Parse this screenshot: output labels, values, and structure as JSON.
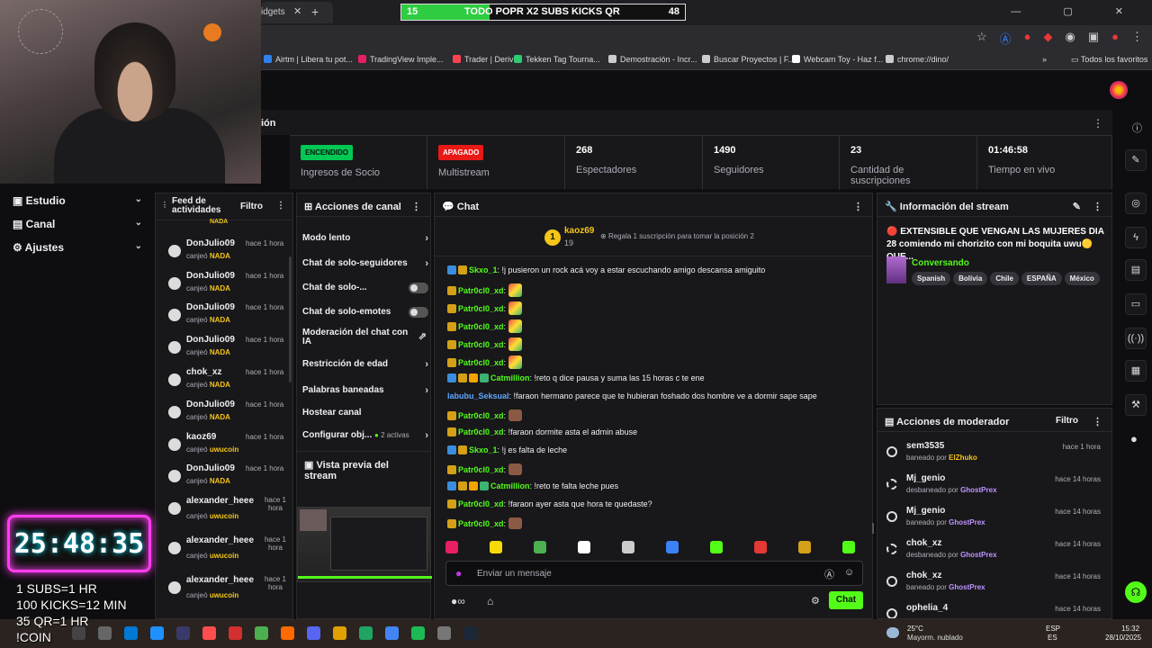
{
  "browser": {
    "tab_title": "idgets",
    "tab_close": "✕",
    "new_tab": "+",
    "window_controls": "— ▢ ✕"
  },
  "goal_bar": {
    "start": "15",
    "text": "TODO POPR X2 SUBS KICKS QR",
    "end": "48",
    "progress": 0.31,
    "color": "#2ecc40"
  },
  "bookmarks": [
    {
      "label": "Airtm | Libera tu pot...",
      "color": "#2f80ed"
    },
    {
      "label": "TradingView Imple...",
      "color": "#e91e63"
    },
    {
      "label": "Trader | Deriv",
      "color": "#ff444f"
    },
    {
      "label": "Tekken Tag Tourna...",
      "color": "#2ecc71"
    },
    {
      "label": "Demostración - Incr...",
      "color": "#cccccc"
    },
    {
      "label": "Buscar Proyectos | F...",
      "color": "#cccccc"
    },
    {
      "label": "Webcam Toy - Haz f...",
      "color": "#ffffff"
    },
    {
      "label": "chrome://dino/",
      "color": "#cccccc"
    }
  ],
  "bookmarks_more": "»",
  "bookmarks_all": "Todos los favoritos",
  "section_title": "ión",
  "stats": [
    {
      "badge": "ENCENDIDO",
      "badge_color": "#00c853",
      "label": "Ingresos de Socio"
    },
    {
      "badge": "APAGADO",
      "badge_color": "#e91916",
      "label": "Multistream"
    },
    {
      "value": "268",
      "label": "Espectadores"
    },
    {
      "value": "1490",
      "label": "Seguidores"
    },
    {
      "value": "23",
      "label": "Cantidad de suscripciones"
    },
    {
      "value": "01:46:58",
      "label": "Tiempo en vivo"
    }
  ],
  "sidebar": {
    "items": [
      {
        "label": "Estudio"
      },
      {
        "label": "Canal"
      },
      {
        "label": "Ajustes"
      }
    ]
  },
  "feed": {
    "title": "Feed de actividades",
    "filter": "Filtro",
    "cut_top": "NADA",
    "items": [
      {
        "name": "DonJulio09",
        "time": "hace 1 hora",
        "action": "canjeó",
        "reward": "NADA"
      },
      {
        "name": "DonJulio09",
        "time": "hace 1 hora",
        "action": "canjeó",
        "reward": "NADA"
      },
      {
        "name": "DonJulio09",
        "time": "hace 1 hora",
        "action": "canjeó",
        "reward": "NADA"
      },
      {
        "name": "DonJulio09",
        "time": "hace 1 hora",
        "action": "canjeó",
        "reward": "NADA"
      },
      {
        "name": "chok_xz",
        "time": "hace 1 hora",
        "action": "canjeó",
        "reward": "NADA"
      },
      {
        "name": "DonJulio09",
        "time": "hace 1 hora",
        "action": "canjeó",
        "reward": "NADA"
      },
      {
        "name": "kaoz69",
        "time": "hace 1 hora",
        "action": "canjeó",
        "reward": "uwucoin"
      },
      {
        "name": "DonJulio09",
        "time": "hace 1 hora",
        "action": "canjeó",
        "reward": "NADA"
      },
      {
        "name": "alexander_heee",
        "time": "hace 1 hora",
        "action": "canjeó",
        "reward": "uwucoin"
      },
      {
        "name": "alexander_heee",
        "time": "hace 1 hora",
        "action": "canjeó",
        "reward": "uwucoin"
      },
      {
        "name": "alexander_heee",
        "time": "hace 1 hora",
        "action": "canjeó",
        "reward": "uwucoin"
      }
    ]
  },
  "actions": {
    "title": "Acciones de canal",
    "items": [
      {
        "label": "Modo lento",
        "type": "arrow"
      },
      {
        "label": "Chat de solo-seguidores",
        "type": "arrow"
      },
      {
        "label": "Chat de solo-...",
        "type": "toggle"
      },
      {
        "label": "Chat de solo-emotes",
        "type": "toggle"
      },
      {
        "label": "Moderación del chat con IA",
        "type": "link"
      },
      {
        "label": "Restricción de edad",
        "type": "arrow"
      },
      {
        "label": "Palabras baneadas",
        "type": "arrow"
      },
      {
        "label": "Hostear canal",
        "type": "none"
      },
      {
        "label": "Configurar obj...",
        "type": "arrow",
        "extra": "2 activas"
      }
    ],
    "preview_title": "Vista previa del stream"
  },
  "chat": {
    "title": "Chat",
    "top_gifter": {
      "name": "kaoz69",
      "count": "19",
      "rank": "1",
      "hint": "Regala 1 suscripción para tomar la posición 2"
    },
    "lines": [
      {
        "user": "Skxo_1",
        "color": "#53fc18",
        "text": "!j pusieron un rock acá voy a estar escuchando amigo descansa amiguito",
        "badges": [
          "#3a8dde",
          "#d4a017"
        ]
      },
      {
        "user": "Patr0cl0_xd",
        "color": "#53fc18",
        "text": "",
        "emote": "rainbow",
        "badges": [
          "#d4a017"
        ]
      },
      {
        "user": "Patr0cl0_xd",
        "color": "#53fc18",
        "text": "",
        "emote": "rainbow",
        "badges": [
          "#d4a017"
        ]
      },
      {
        "user": "Patr0cl0_xd",
        "color": "#53fc18",
        "text": "",
        "emote": "rainbow",
        "badges": [
          "#d4a017"
        ]
      },
      {
        "user": "Patr0cl0_xd",
        "color": "#53fc18",
        "text": "",
        "emote": "rainbow",
        "badges": [
          "#d4a017"
        ]
      },
      {
        "user": "Patr0cl0_xd",
        "color": "#53fc18",
        "text": "",
        "emote": "rainbow",
        "badges": [
          "#d4a017"
        ]
      },
      {
        "user": "Catmillion",
        "color": "#53fc18",
        "text": "!reto q dice pausa y suma las 15 horas c te ene",
        "badges": [
          "#3a8dde",
          "#d4a017",
          "#f5a300",
          "#3cb371"
        ]
      },
      {
        "user": "labubu_Seksual",
        "color": "#5fa8ff",
        "text": "!faraon hermano parece que te hubieran foshado dos hombre ve a dormir sape sape",
        "badges": []
      },
      {
        "user": "Patr0cl0_xd",
        "color": "#53fc18",
        "text": "",
        "emote": "brown",
        "badges": [
          "#d4a017"
        ]
      },
      {
        "user": "Patr0cl0_xd",
        "color": "#53fc18",
        "text": "!faraon dormite asta el admin abuse",
        "badges": [
          "#d4a017"
        ]
      },
      {
        "user": "Skxo_1",
        "color": "#53fc18",
        "text": "!j es falta de leche",
        "badges": [
          "#3a8dde",
          "#d4a017"
        ]
      },
      {
        "user": "Patr0cl0_xd",
        "color": "#53fc18",
        "text": "",
        "emote": "brown",
        "badges": [
          "#d4a017"
        ]
      },
      {
        "user": "Catmillion",
        "color": "#53fc18",
        "text": "!reto te falta leche pues",
        "badges": [
          "#3a8dde",
          "#d4a017",
          "#f5a300",
          "#3cb371"
        ]
      },
      {
        "user": "Patr0cl0_xd",
        "color": "#53fc18",
        "text": "!faraon ayer asta que hora te quedaste?",
        "badges": [
          "#d4a017"
        ]
      },
      {
        "user": "Patr0cl0_xd",
        "color": "#53fc18",
        "text": "",
        "emote": "brown",
        "badges": [
          "#d4a017"
        ]
      }
    ],
    "emote_bar": [
      "#e91e63",
      "#f5d90a",
      "#4caf50",
      "#ffffff",
      "#cccccc",
      "#3b82f6",
      "#53fc18",
      "#e53935",
      "#d4a017",
      "#53fc18"
    ],
    "input_placeholder": "Enviar un mensaje",
    "send_label": "Chat"
  },
  "stream_info": {
    "title": "Información del stream",
    "stream_title": "🔴 EXTENSIBLE QUE VENGAN LAS MUJERES DIA 28 comiendo mi chorizito con mi boquita uwu🟡 QUE...",
    "category": "Conversando",
    "tags": [
      "Spanish",
      "Bolivia",
      "Chile",
      "ESPAÑA",
      "México"
    ]
  },
  "mod_actions": {
    "title": "Acciones de moderador",
    "filter": "Filtro",
    "items": [
      {
        "name": "sem3535",
        "action": "baneado por",
        "by": "ElZhuko",
        "time": "hace 1 hora",
        "icon": "ban"
      },
      {
        "name": "Mj_genio",
        "action": "desbaneado por",
        "by": "GhostPrex",
        "time": "hace 14 horas",
        "icon": "unban"
      },
      {
        "name": "Mj_genio",
        "action": "baneado por",
        "by": "GhostPrex",
        "time": "hace 14 horas",
        "icon": "ban"
      },
      {
        "name": "chok_xz",
        "action": "desbaneado por",
        "by": "GhostPrex",
        "time": "hace 14 horas",
        "icon": "unban"
      },
      {
        "name": "chok_xz",
        "action": "baneado por",
        "by": "GhostPrex",
        "time": "hace 14 horas",
        "icon": "ban"
      },
      {
        "name": "ophelia_4",
        "action": "",
        "by": "",
        "time": "hace 14 horas",
        "icon": "ban"
      }
    ]
  },
  "overlay": {
    "timer": "25:48:35",
    "lines": [
      "1 SUBS=1 HR",
      "100 KICKS=12 MIN",
      "35 QR=1 HR",
      "!COIN"
    ]
  },
  "taskbar": {
    "weather_temp": "25°C",
    "weather_desc": "Mayorm. nublado",
    "lang_1": "ESP",
    "lang_2": "ES",
    "time": "15:32",
    "date": "28/10/2025"
  }
}
